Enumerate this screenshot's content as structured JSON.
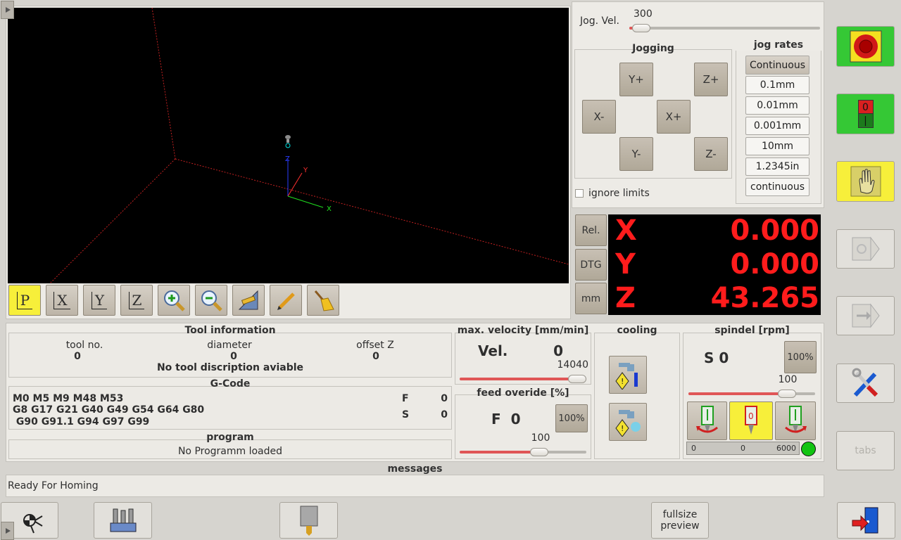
{
  "jog": {
    "vel_label": "Jog. Vel.",
    "vel_value": "300",
    "vel_fraction": 0.06,
    "jogging_title": "Jogging",
    "buttons": {
      "y_plus": "Y+",
      "z_plus": "Z+",
      "x_minus": "X-",
      "x_plus": "X+",
      "y_minus": "Y-",
      "z_minus": "Z-"
    },
    "ignore_limits": "ignore limits",
    "rates_title": "jog rates",
    "rates": [
      "Continuous",
      "0.1mm",
      "0.01mm",
      "0.001mm",
      "10mm",
      "1.2345in",
      "continuous"
    ]
  },
  "dro": {
    "mode_buttons": [
      "Rel.",
      "DTG",
      "mm"
    ],
    "axes": [
      {
        "name": "X",
        "value": "0.000"
      },
      {
        "name": "Y",
        "value": "0.000"
      },
      {
        "name": "Z",
        "value": "43.265"
      }
    ]
  },
  "preview": {
    "view_buttons": [
      "P",
      "X",
      "Y",
      "Z"
    ],
    "axis_labels": {
      "x": "X",
      "y": "Y",
      "z": "Z"
    }
  },
  "tool": {
    "title": "Tool information",
    "headers": [
      "tool no.",
      "diameter",
      "offset Z"
    ],
    "values": [
      "0",
      "0",
      "0"
    ],
    "description": "No tool discription aviable"
  },
  "gcode": {
    "title": "G-Code",
    "lines": [
      "M0 M5 M9 M48 M53",
      "G8 G17 G21 G40 G49 G54 G64 G80",
      " G90 G91.1 G94 G97 G99"
    ],
    "f_label": "F",
    "f_value": "0",
    "s_label": "S",
    "s_value": "0"
  },
  "program": {
    "title": "program",
    "status": "No Programm loaded"
  },
  "velocity": {
    "title": "max. velocity [mm/min]",
    "label": "Vel.",
    "value": "0",
    "max": "14040",
    "fraction": 1.0
  },
  "feed": {
    "title": "feed overide [%]",
    "label": "F  0",
    "reset": "100%",
    "value": "100",
    "fraction": 0.63
  },
  "cooling": {
    "title": "cooling"
  },
  "spindle": {
    "title": "spindel [rpm]",
    "label": "S 0",
    "reset": "100%",
    "value": "100",
    "fraction": 0.78,
    "bar_min": "0",
    "bar_mid": "0",
    "bar_max": "6000",
    "status_color": "#12c412"
  },
  "messages": {
    "title": "messages",
    "text": "Ready For Homing"
  },
  "bottom": {
    "fullsize_line1": "fullsize",
    "fullsize_line2": "preview"
  },
  "right": {
    "estop_label": "0",
    "estop_sub": "|",
    "tabs_label": "tabs"
  },
  "colors": {
    "dro_text": "#ff1c1c",
    "accent_yellow": "#f7ef3a",
    "green": "#35c835"
  }
}
